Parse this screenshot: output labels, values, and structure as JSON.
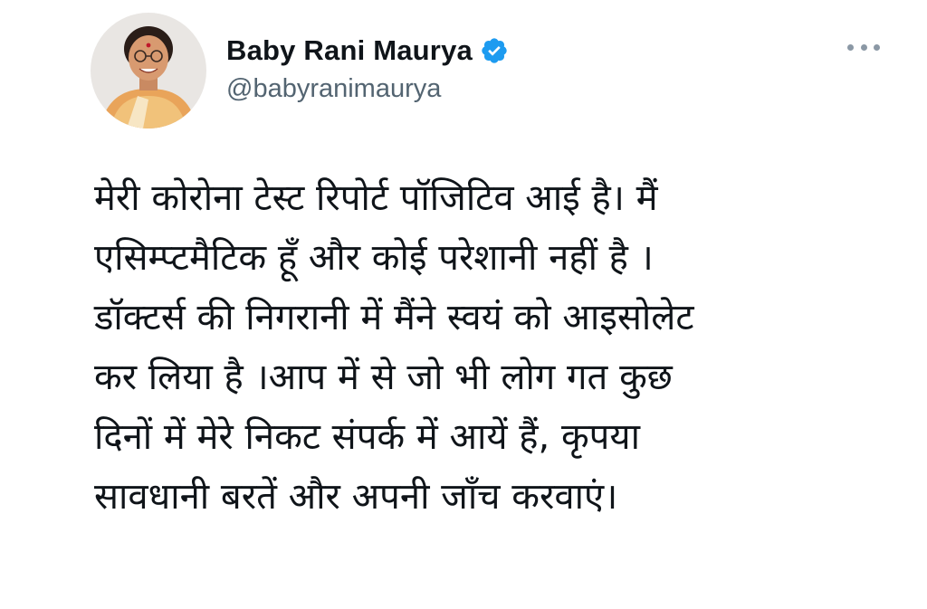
{
  "author": {
    "display_name": "Baby Rani Maurya",
    "handle": "@babyranimaurya",
    "verified": true,
    "avatar_icon": "profile-photo",
    "verified_icon": "verified-badge-icon",
    "verified_color": "#1d9bf0"
  },
  "more_icon": "more-options-icon",
  "tweet": {
    "lines": [
      "मेरी कोरोना टेस्ट रिपोर्ट पॉजिटिव आई है। मैं",
      "एसिम्प्टमैटिक हूँ और कोई परेशानी नहीं है ।",
      "डॉक्टर्स की निगरानी में मैंने स्वयं को आइसोलेट",
      "कर लिया है ।आप में से जो भी लोग गत कुछ",
      "दिनों में मेरे निकट संपर्क में आयें हैं, कृपया",
      "सावधानी बरतें और अपनी जाँच करवाएं।"
    ]
  },
  "colors": {
    "text": "#0f1419",
    "secondary_text": "#536471",
    "accent": "#1d9bf0",
    "background": "#ffffff"
  }
}
